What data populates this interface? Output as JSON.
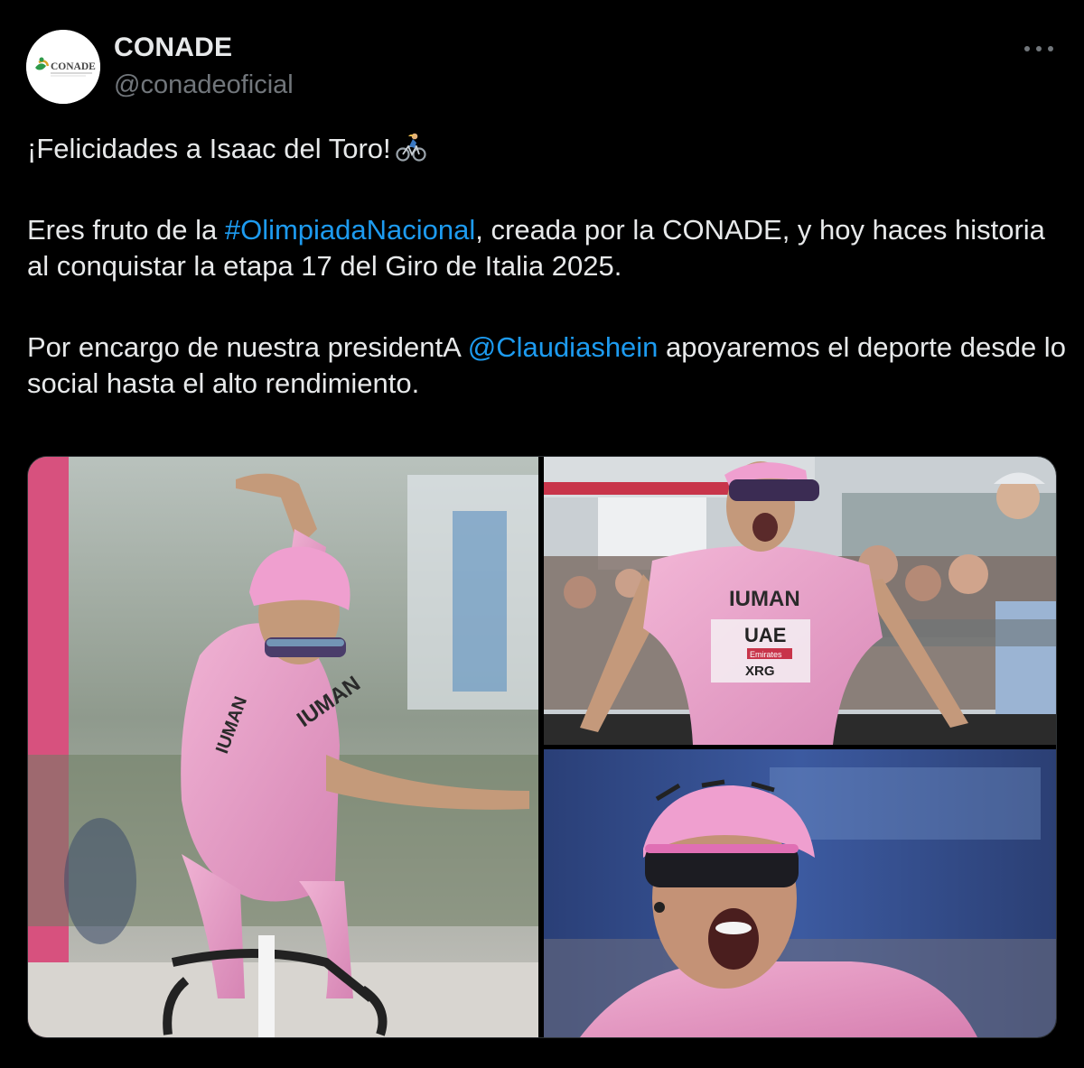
{
  "account": {
    "display_name": "CONADE",
    "handle": "@conadeoficial",
    "avatar_text": "CONADE"
  },
  "tweet": {
    "line1": "¡Felicidades a Isaac del Toro!",
    "line1_emoji": "bicyclist-icon",
    "p2_before": "Eres fruto de la ",
    "p2_hashtag": "#OlimpiadaNacional",
    "p2_after": ", creada por la CONADE, y hoy haces historia al conquistar la etapa 17 del Giro de Italia 2025.",
    "p3_before": "Por encargo de nuestra presidentA ",
    "p3_mention": "@Claudiashein",
    "p3_after": " apoyaremos el deporte desde lo social hasta el alto rendimiento."
  },
  "media": {
    "count": 3,
    "jersey_text_1": "IUMAN",
    "jersey_text_2": "UAE",
    "jersey_text_3": "Emirates",
    "jersey_text_4": "XRG"
  },
  "colors": {
    "background": "#000000",
    "text": "#e7e9ea",
    "secondary": "#71767b",
    "link": "#1d9bf0",
    "jersey_pink": "#e8a0c8"
  }
}
